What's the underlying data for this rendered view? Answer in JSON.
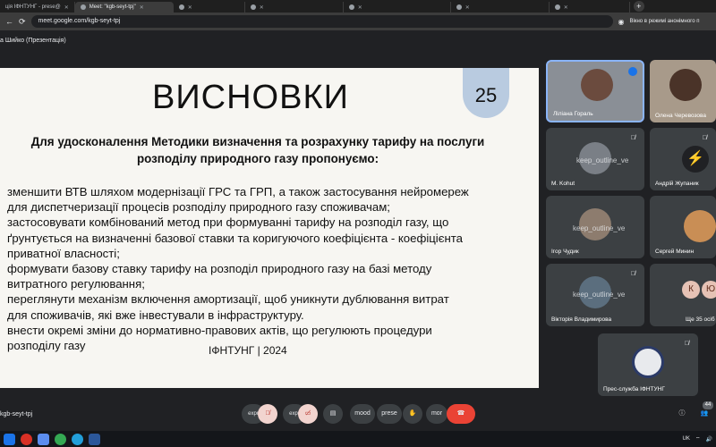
{
  "browser": {
    "tabs": [
      {
        "label": "ція ІФНТУНГ - prese@",
        "active": false
      },
      {
        "label": "Meet: \"kgb-seyt-tpj\"",
        "active": true
      },
      {
        "label": "",
        "active": false
      },
      {
        "label": "",
        "active": false
      },
      {
        "label": "",
        "active": false
      },
      {
        "label": "",
        "active": false
      },
      {
        "label": "",
        "active": false
      }
    ],
    "url": "meet.google.com/kgb-seyt-tpj",
    "incognito_label": "Вікно в режимі анонімного п"
  },
  "meet": {
    "presenting_label": "а Шийко (Презентація)",
    "meeting_code": "kgb-seyt-tpj",
    "participant_count": "44",
    "participants": [
      {
        "name": "Лілiана Гораль"
      },
      {
        "name": "Олена Черевозова"
      },
      {
        "name": "M. Kohut"
      },
      {
        "name": "Андрій Жупаник"
      },
      {
        "name": "Ігор Чудик"
      },
      {
        "name": "Сергей Минин"
      },
      {
        "name": "Вікторія Владимирова"
      },
      {
        "name": "Ще 35 осіб"
      },
      {
        "name": "Прес-служба ІФНТУНГ"
      }
    ],
    "others_initials": [
      "К",
      "Ю"
    ],
    "overlay_text": "keep_outline_ve",
    "controls": {
      "pill1": "expr",
      "pill2": "expr",
      "mood": "mood",
      "present": "prese",
      "more": "mor"
    }
  },
  "slide": {
    "title": "ВИСНОВКИ",
    "number": "25",
    "heading": "Для удосконалення Методики визначення та розрахунку тарифу на послуги розподілу природного газу пропонуємо:",
    "body": [
      "зменшити ВТВ шляхом модернізації ГРС та ГРП, а також застосування нейромереж",
      "для диспетчеризації процесів розподілу природного газу споживачам;",
      "застосовувати комбінований метод при формуванні тарифу на розподіл газу, що",
      "ґрунтується на визначенні базової ставки та коригуючого коефіцієнта - коефіцієнта",
      "приватної власності;",
      "формувати базову ставку  тарифу на розподіл природного газу на базі методу",
      "витратного регулювання;",
      "переглянути механізм включення амортизації, щоб уникнути дублювання витрат",
      "для споживачів, які вже інвестували в інфраструктуру.",
      "внести окремі зміни до нормативно-правових актів, що регулюють процедури",
      "розподілу газу"
    ],
    "footer": "ІФНТУНГ | 2024"
  },
  "taskbar": {
    "lang": "UK"
  }
}
